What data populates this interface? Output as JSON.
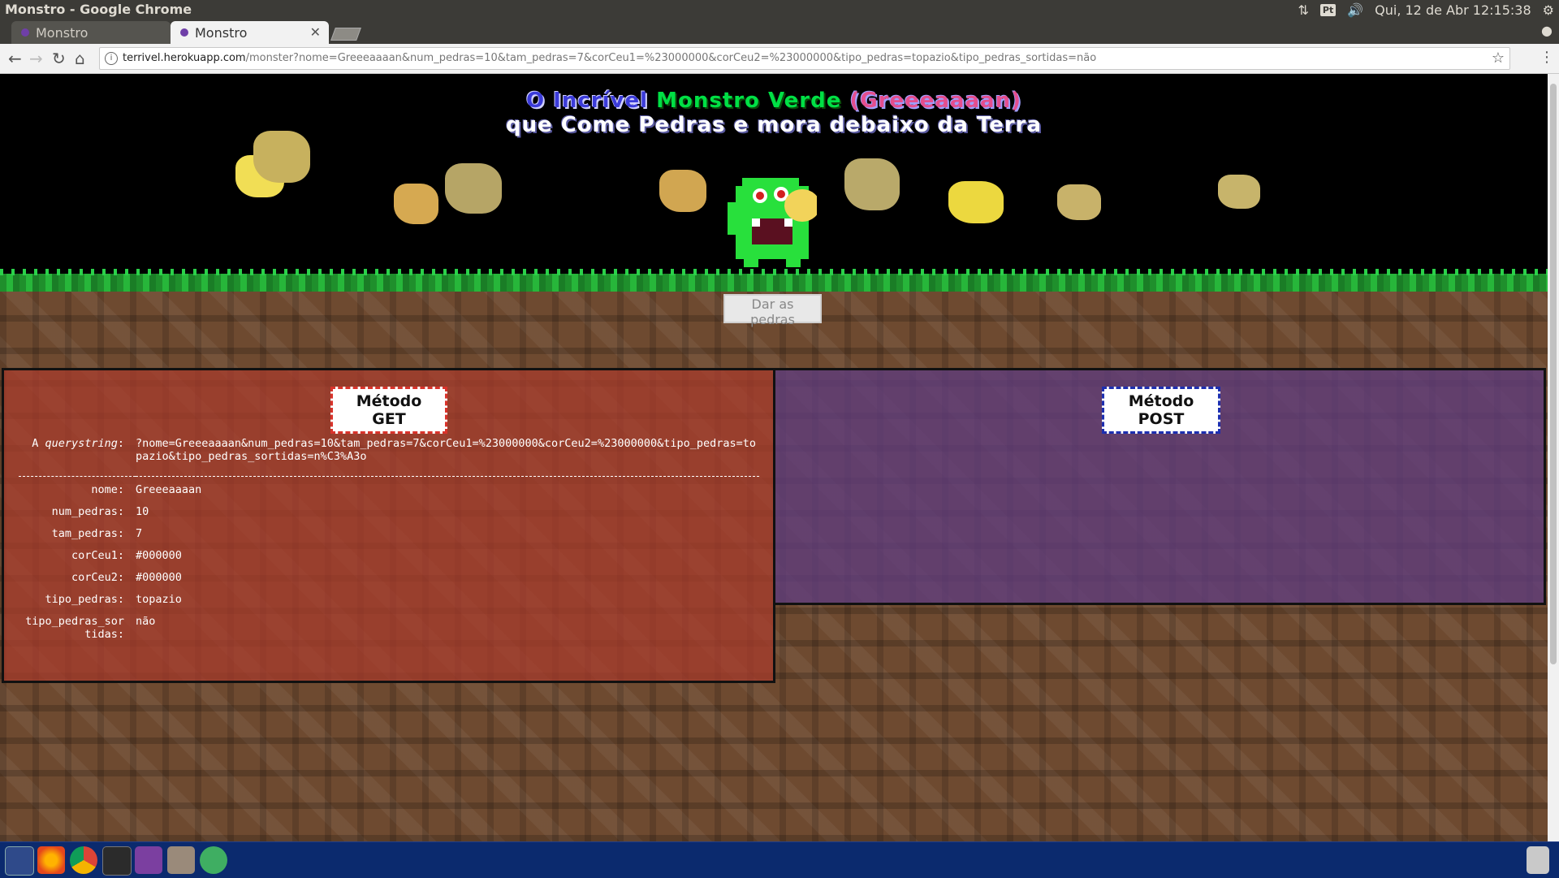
{
  "os": {
    "window_title": "Monstro - Google Chrome",
    "keyboard_layout": "Pt",
    "clock": "Qui, 12 de Abr 12:15:38"
  },
  "browser": {
    "tabs": [
      {
        "label": "Monstro",
        "active": false
      },
      {
        "label": "Monstro",
        "active": true
      }
    ],
    "url_host": "terrivel.herokuapp.com",
    "url_path": "/monster?nome=Greeeaaaan&num_pedras=10&tam_pedras=7&corCeu1=%23000000&corCeu2=%23000000&tipo_pedras=topazio&tipo_pedras_sortidas=não"
  },
  "heading": {
    "part1": "O Incrível",
    "part2": "Monstro Verde",
    "part3": "(Greeeaaaan)",
    "line2": "que Come Pedras e mora debaixo da Terra"
  },
  "give_button": "Dar as pedras",
  "get_panel": {
    "title": "Método GET",
    "querystring_label_prefix": "A ",
    "querystring_label_em": "querystring",
    "querystring_label_suffix": ":",
    "querystring_value": "?nome=Greeeaaaan&num_pedras=10&tam_pedras=7&corCeu1=%23000000&corCeu2=%23000000&tipo_pedras=topazio&tipo_pedras_sortidas=n%C3%A3o",
    "params": [
      {
        "key": "nome:",
        "value": "Greeeaaaan"
      },
      {
        "key": "num_pedras:",
        "value": "10"
      },
      {
        "key": "tam_pedras:",
        "value": "7"
      },
      {
        "key": "corCeu1:",
        "value": "#000000"
      },
      {
        "key": "corCeu2:",
        "value": "#000000"
      },
      {
        "key": "tipo_pedras:",
        "value": "topazio"
      },
      {
        "key": "tipo_pedras_sortidas:",
        "value": "não"
      }
    ]
  },
  "post_panel": {
    "title": "Método POST"
  },
  "taskbar": {
    "apps": [
      "ubuntu-icon",
      "firefox-icon",
      "chrome-icon",
      "terminal-icon",
      "media-icon",
      "files-icon",
      "app-icon"
    ]
  },
  "colors": {
    "monster": "#28e03c",
    "stone_light": "#f2d35a",
    "stone_dark": "#b9a65a"
  }
}
